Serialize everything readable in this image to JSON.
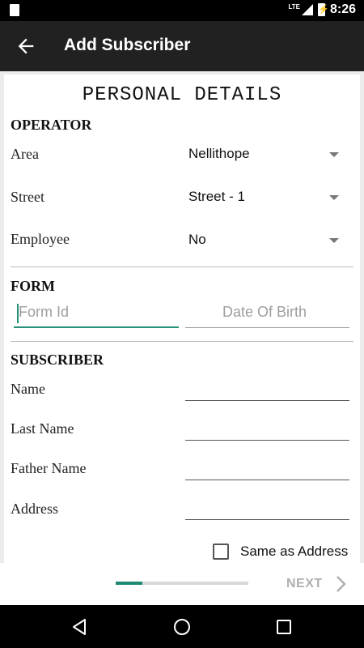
{
  "status_bar": {
    "time": "8:26",
    "network": "LTE",
    "icons": [
      "sd-card-icon",
      "signal-icon",
      "battery-icon"
    ]
  },
  "toolbar": {
    "title": "Add Subscriber",
    "back_icon": "arrow-left-icon"
  },
  "page": {
    "heading": "PERSONAL DETAILS"
  },
  "operator": {
    "section_label": "OPERATOR",
    "area_label": "Area",
    "area_value": "Nellithope",
    "street_label": "Street",
    "street_value": "Street - 1",
    "employee_label": "Employee",
    "employee_value": "No"
  },
  "form": {
    "section_label": "FORM",
    "form_id_placeholder": "Form Id",
    "dob_placeholder": "Date Of Birth"
  },
  "subscriber": {
    "section_label": "SUBSCRIBER",
    "name_label": "Name",
    "last_name_label": "Last Name",
    "father_name_label": "Father Name",
    "address_label": "Address",
    "same_as_address_label": "Same as Address",
    "same_as_address_checked": false
  },
  "footer": {
    "next_label": "NEXT",
    "progress": 0.2
  },
  "colors": {
    "accent": "#26907a",
    "toolbar": "#212121",
    "text": "#111111"
  }
}
